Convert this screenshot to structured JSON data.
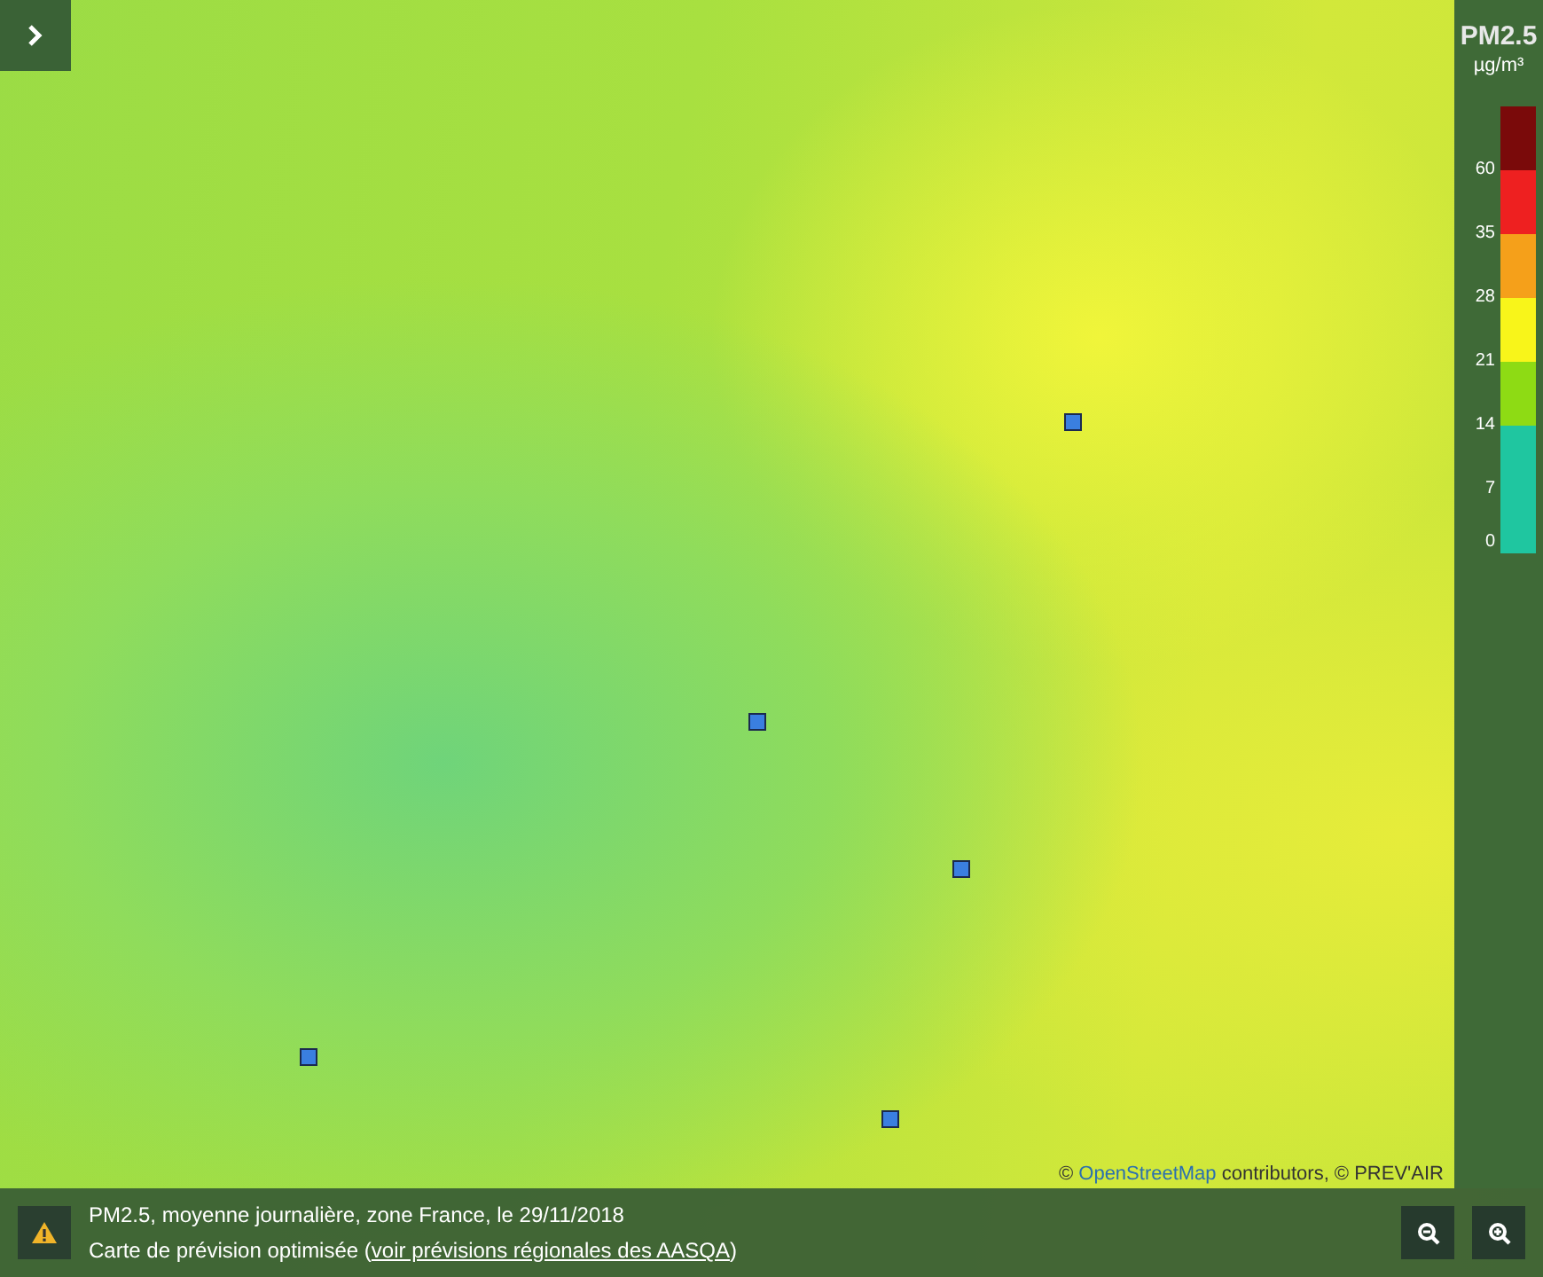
{
  "legend": {
    "title": "PM2.5",
    "unit": "µg/m³",
    "bands": [
      {
        "color": "#7a0a0a"
      },
      {
        "color": "#ee2020"
      },
      {
        "color": "#f5a01a"
      },
      {
        "color": "#f8f51a"
      },
      {
        "color": "#8edb14"
      },
      {
        "color": "#1fc6a0"
      }
    ],
    "ticks": [
      "60",
      "35",
      "28",
      "21",
      "14",
      "7",
      "0"
    ]
  },
  "attribution": {
    "prefix": "©",
    "link": "OpenStreetMap",
    "suffix": "contributors, © PREV'AIR"
  },
  "info": {
    "line_1": "PM2.5, moyenne journalière, zone France, le 29/11/2018",
    "line_2_prefix": "Carte de prévision optimisée (",
    "line_2_link": "voir prévisions régionales des AASQA",
    "line_2_suffix": ")"
  }
}
